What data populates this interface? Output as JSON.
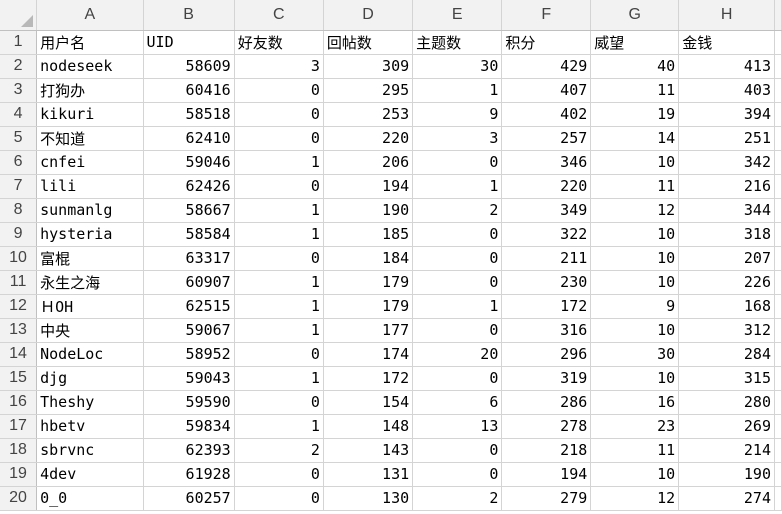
{
  "columns": [
    "A",
    "B",
    "C",
    "D",
    "E",
    "F",
    "G",
    "H"
  ],
  "header_row": {
    "row_number": "1",
    "cells": [
      "用户名",
      "UID",
      "好友数",
      "回帖数",
      "主题数",
      "积分",
      "威望",
      "金钱"
    ]
  },
  "rows": [
    {
      "n": "2",
      "cells": [
        "nodeseek",
        "58609",
        "3",
        "309",
        "30",
        "429",
        "40",
        "413"
      ]
    },
    {
      "n": "3",
      "cells": [
        "打狗办",
        "60416",
        "0",
        "295",
        "1",
        "407",
        "11",
        "403"
      ]
    },
    {
      "n": "4",
      "cells": [
        "kikuri",
        "58518",
        "0",
        "253",
        "9",
        "402",
        "19",
        "394"
      ]
    },
    {
      "n": "5",
      "cells": [
        "不知道",
        "62410",
        "0",
        "220",
        "3",
        "257",
        "14",
        "251"
      ]
    },
    {
      "n": "6",
      "cells": [
        "cnfei",
        "59046",
        "1",
        "206",
        "0",
        "346",
        "10",
        "342"
      ]
    },
    {
      "n": "7",
      "cells": [
        "lili",
        "62426",
        "0",
        "194",
        "1",
        "220",
        "11",
        "216"
      ]
    },
    {
      "n": "8",
      "cells": [
        "sunmanlg",
        "58667",
        "1",
        "190",
        "2",
        "349",
        "12",
        "344"
      ]
    },
    {
      "n": "9",
      "cells": [
        "hysteria",
        "58584",
        "1",
        "185",
        "0",
        "322",
        "10",
        "318"
      ]
    },
    {
      "n": "10",
      "cells": [
        "富棍",
        "63317",
        "0",
        "184",
        "0",
        "211",
        "10",
        "207"
      ]
    },
    {
      "n": "11",
      "cells": [
        "永生之海",
        "60907",
        "1",
        "179",
        "0",
        "230",
        "10",
        "226"
      ]
    },
    {
      "n": "12",
      "cells": [
        "ＨOH",
        "62515",
        "1",
        "179",
        "1",
        "172",
        "9",
        "168"
      ]
    },
    {
      "n": "13",
      "cells": [
        "中央",
        "59067",
        "1",
        "177",
        "0",
        "316",
        "10",
        "312"
      ]
    },
    {
      "n": "14",
      "cells": [
        "NodeLoc",
        "58952",
        "0",
        "174",
        "20",
        "296",
        "30",
        "284"
      ]
    },
    {
      "n": "15",
      "cells": [
        "djg",
        "59043",
        "1",
        "172",
        "0",
        "319",
        "10",
        "315"
      ]
    },
    {
      "n": "16",
      "cells": [
        "Theshy",
        "59590",
        "0",
        "154",
        "6",
        "286",
        "16",
        "280"
      ]
    },
    {
      "n": "17",
      "cells": [
        "hbetv",
        "59834",
        "1",
        "148",
        "13",
        "278",
        "23",
        "269"
      ]
    },
    {
      "n": "18",
      "cells": [
        "sbrvnc",
        "62393",
        "2",
        "143",
        "0",
        "218",
        "11",
        "214"
      ]
    },
    {
      "n": "19",
      "cells": [
        "4dev",
        "61928",
        "0",
        "131",
        "0",
        "194",
        "10",
        "190"
      ]
    },
    {
      "n": "20",
      "cells": [
        "0_0",
        "60257",
        "0",
        "130",
        "2",
        "279",
        "12",
        "274"
      ]
    }
  ],
  "icons": {
    "select_all": "select-all-triangle-icon"
  },
  "colors": {
    "header_bg": "#f2f2f2",
    "gridline": "#d4d4d4",
    "header_text": "#444444"
  }
}
